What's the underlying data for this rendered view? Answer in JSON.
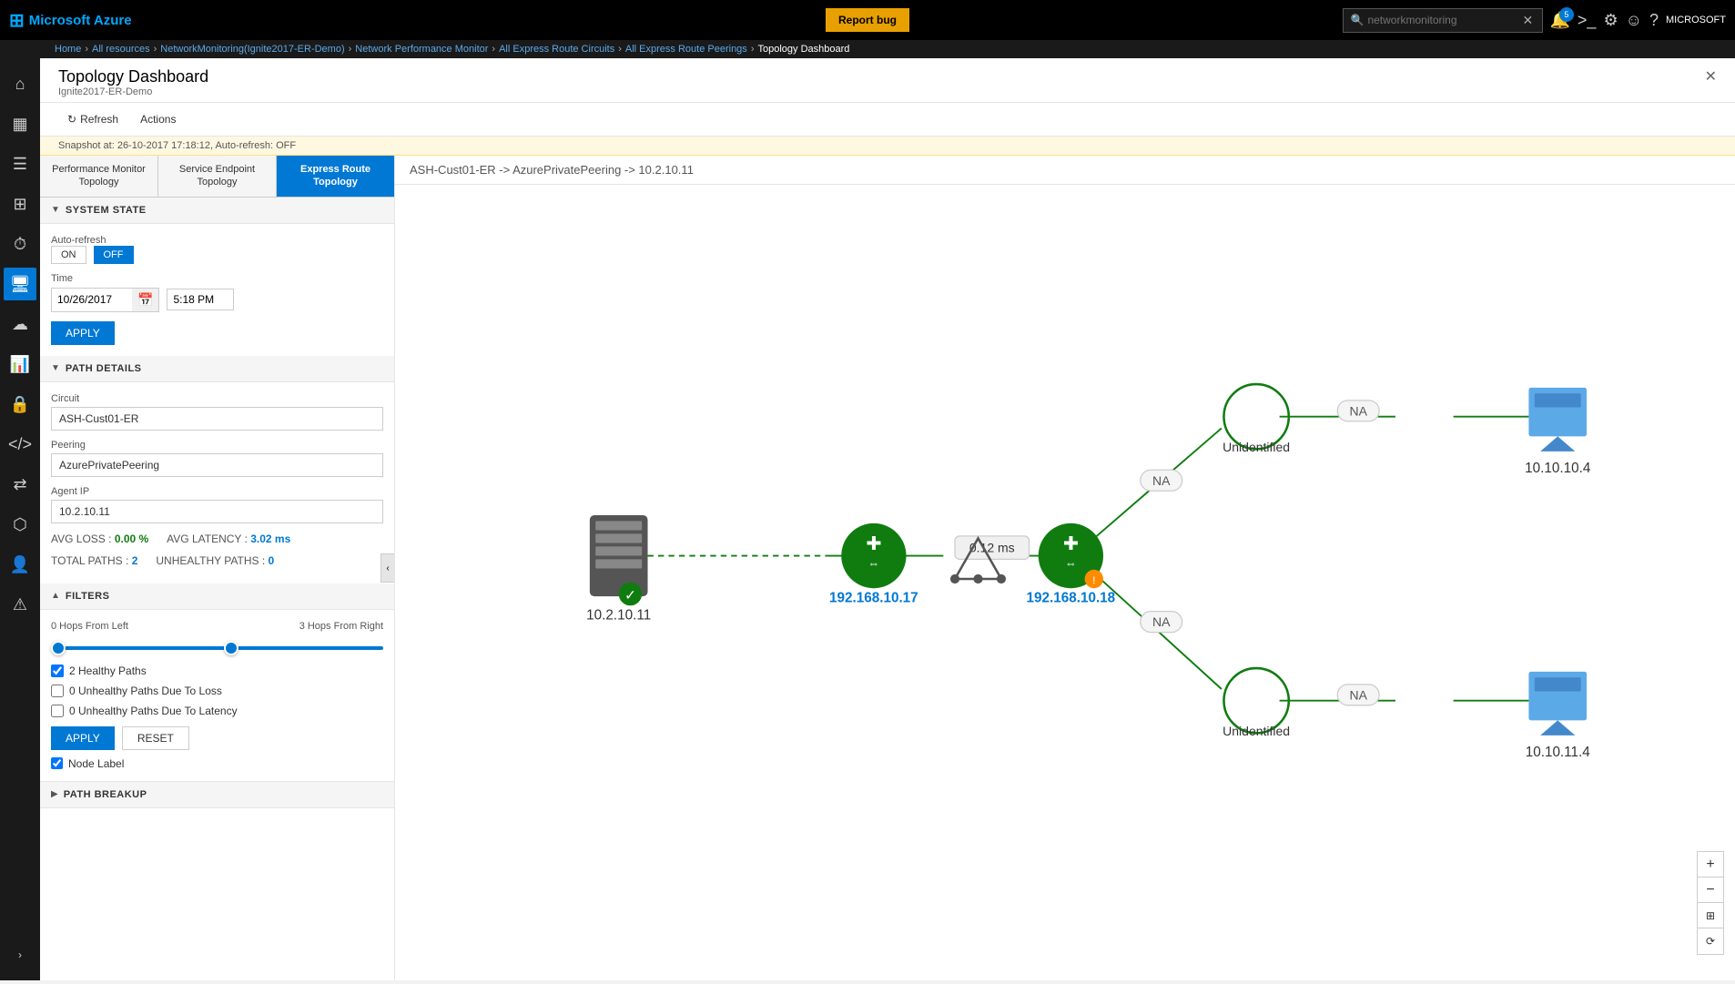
{
  "topbar": {
    "azure_logo": "Microsoft Azure",
    "report_bug": "Report bug",
    "search_placeholder": "networkmonitoring",
    "notification_count": "5",
    "user_name": "MICROSOFT"
  },
  "breadcrumb": {
    "items": [
      "Home",
      "All resources",
      "NetworkMonitoring(Ignite2017-ER-Demo)",
      "Network Performance Monitor",
      "All Express Route Circuits",
      "All Express Route Peerings",
      "Topology Dashboard"
    ]
  },
  "page": {
    "title": "Topology Dashboard",
    "subtitle": "Ignite2017-ER-Demo",
    "toolbar": {
      "refresh": "Refresh",
      "actions": "Actions"
    },
    "snapshot": "Snapshot at: 26-10-2017 17:18:12, Auto-refresh: OFF"
  },
  "tabs": [
    {
      "id": "perf",
      "label": "Performance Monitor Topology"
    },
    {
      "id": "service",
      "label": "Service Endpoint Topology"
    },
    {
      "id": "express",
      "label": "Express Route Topology"
    }
  ],
  "system_state": {
    "section_title": "SYSTEM STATE",
    "auto_refresh_label": "Auto-refresh",
    "on_label": "ON",
    "off_label": "OFF",
    "time_label": "Time",
    "date_value": "10/26/2017",
    "time_value": "5:18 PM",
    "apply_label": "APPLY"
  },
  "path_details": {
    "section_title": "PATH DETAILS",
    "circuit_label": "Circuit",
    "circuit_value": "ASH-Cust01-ER",
    "peering_label": "Peering",
    "peering_value": "AzurePrivatePeering",
    "agent_ip_label": "Agent IP",
    "agent_ip_value": "10.2.10.11",
    "avg_loss_label": "AVG LOSS :",
    "avg_loss_value": "0.00 %",
    "avg_latency_label": "AVG LATENCY :",
    "avg_latency_value": "3.02 ms",
    "total_paths_label": "TOTAL PATHS :",
    "total_paths_value": "2",
    "unhealthy_paths_label": "UNHEALTHY PATHS :",
    "unhealthy_paths_value": "0"
  },
  "filters": {
    "section_title": "FILTERS",
    "hops_left_label": "0 Hops From Left",
    "hops_right_label": "3 Hops From Right",
    "healthy_paths_label": "2 Healthy Paths",
    "unhealthy_loss_label": "0 Unhealthy Paths Due To Loss",
    "unhealthy_latency_label": "0 Unhealthy Paths Due To Latency",
    "apply_label": "APPLY",
    "reset_label": "RESET",
    "node_label": "Node Label",
    "healthy_checked": true,
    "loss_checked": false,
    "latency_checked": false,
    "node_label_checked": true
  },
  "path_breakup": {
    "section_title": "PATH BREAKUP"
  },
  "topology": {
    "breadcrumb": "ASH-Cust01-ER -> AzurePrivatePeering -> 10.2.10.11",
    "nodes": {
      "source_ip": "10.2.10.11",
      "router1_ip": "192.168.10.17",
      "router2_ip": "192.168.10.18",
      "upper_unidentified": "Unidentified",
      "lower_unidentified": "Unidentified",
      "upper_dest_ip": "10.10.10.4",
      "lower_dest_ip": "10.10.11.4",
      "latency_label": "0.12 ms",
      "na_labels": [
        "NA",
        "NA",
        "NA",
        "NA"
      ]
    }
  },
  "zoom": {
    "plus": "+",
    "minus": "−",
    "fit": "⊞",
    "reset": "⟳"
  }
}
